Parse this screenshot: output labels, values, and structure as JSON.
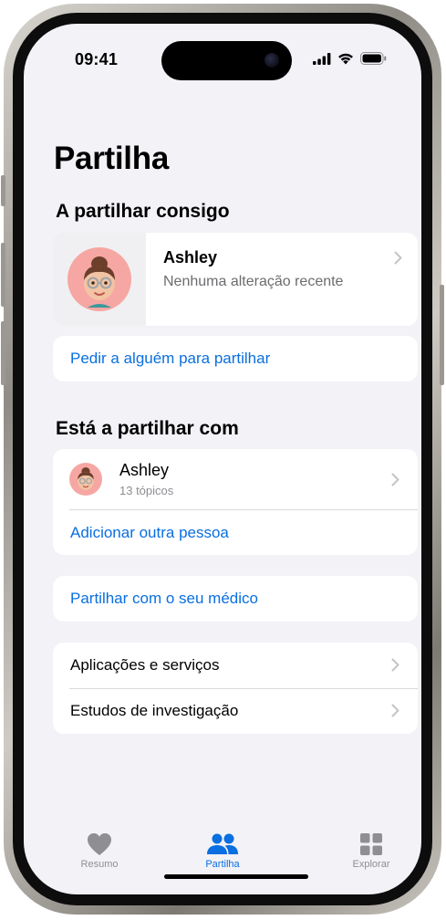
{
  "status_bar": {
    "time": "09:41"
  },
  "page": {
    "title": "Partilha"
  },
  "shared_with_you": {
    "section_title": "A partilhar consigo",
    "person": {
      "name": "Ashley",
      "subtitle": "Nenhuma alteração recente"
    },
    "ask_link": "Pedir a alguém para partilhar"
  },
  "you_share_with": {
    "section_title": "Está a partilhar com",
    "person": {
      "name": "Ashley",
      "subtitle": "13 tópicos"
    },
    "add_link": "Adicionar outra pessoa"
  },
  "doctor_link": "Partilhar com o seu médico",
  "more_rows": [
    {
      "label": "Aplicações e serviços"
    },
    {
      "label": "Estudos de investigação"
    }
  ],
  "tabbar": {
    "tabs": [
      {
        "label": "Resumo",
        "icon": "heart-icon",
        "active": false
      },
      {
        "label": "Partilha",
        "icon": "people-icon",
        "active": true
      },
      {
        "label": "Explorar",
        "icon": "grid-icon",
        "active": false
      }
    ]
  },
  "colors": {
    "accent": "#0a6fe0",
    "background": "#f2f2f7",
    "card": "#ffffff",
    "inactive_tab": "#8e8e93",
    "avatar_bg": "#f6a7a3"
  }
}
